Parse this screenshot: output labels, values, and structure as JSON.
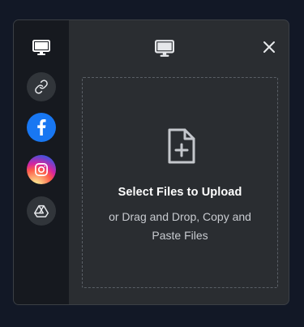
{
  "dialog": {
    "close_icon": "close-icon",
    "header_icon": "monitor-icon"
  },
  "sidebar": {
    "items": [
      {
        "icon": "monitor-icon",
        "name": "device"
      },
      {
        "icon": "link-icon",
        "name": "link"
      },
      {
        "icon": "facebook-icon",
        "name": "facebook",
        "color": "#1877f2"
      },
      {
        "icon": "instagram-icon",
        "name": "instagram"
      },
      {
        "icon": "google-drive-icon",
        "name": "google-drive"
      }
    ]
  },
  "dropzone": {
    "icon": "file-plus-icon",
    "title": "Select Files to Upload",
    "subtitle": "or Drag and Drop, Copy and Paste Files"
  },
  "colors": {
    "background": "#121826",
    "panel": "#2a2d31",
    "sidebar": "#16191f",
    "text_primary": "#ffffff",
    "text_secondary": "#c8cbd0"
  }
}
